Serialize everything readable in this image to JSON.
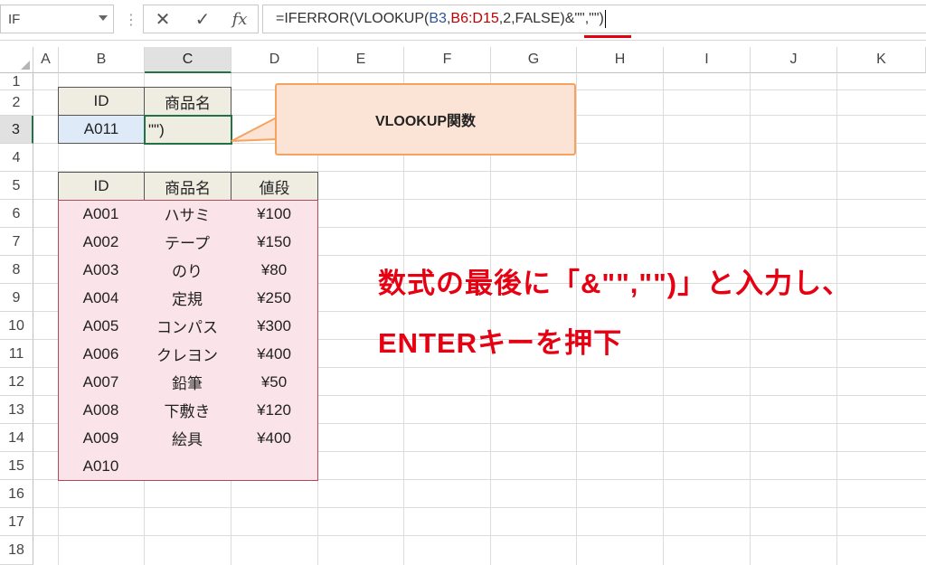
{
  "formula_bar": {
    "name_box": "IF",
    "cancel_icon": "✕",
    "enter_icon": "✓",
    "fx_label": "fx",
    "formula_parts": [
      "=IFERROR(VLOOKUP(",
      "B3",
      ",",
      "B6:D15",
      ",2,FALSE)&\"\",\"\")"
    ]
  },
  "columns": [
    "A",
    "B",
    "C",
    "D",
    "E",
    "F",
    "G",
    "H",
    "I",
    "J",
    "K"
  ],
  "rows": [
    "1",
    "2",
    "3",
    "4",
    "5",
    "6",
    "7",
    "8",
    "9",
    "10",
    "11",
    "12",
    "13",
    "14",
    "15",
    "16",
    "17",
    "18"
  ],
  "lookup": {
    "header_id": "ID",
    "header_name": "商品名",
    "id_value": "A011",
    "editing_value": "\"\")"
  },
  "table": {
    "headers": [
      "ID",
      "商品名",
      "値段"
    ],
    "rows": [
      [
        "A001",
        "ハサミ",
        "¥100"
      ],
      [
        "A002",
        "テープ",
        "¥150"
      ],
      [
        "A003",
        "のり",
        "¥80"
      ],
      [
        "A004",
        "定規",
        "¥250"
      ],
      [
        "A005",
        "コンパス",
        "¥300"
      ],
      [
        "A006",
        "クレヨン",
        "¥400"
      ],
      [
        "A007",
        "鉛筆",
        "¥50"
      ],
      [
        "A008",
        "下敷き",
        "¥120"
      ],
      [
        "A009",
        "絵具",
        "¥400"
      ],
      [
        "A010",
        "",
        ""
      ]
    ]
  },
  "callout": {
    "text": "VLOOKUP関数"
  },
  "annotation": {
    "line1": "数式の最後に「&\"\",\"\")」と入力し、",
    "line2": "ENTERキーを押下"
  },
  "colors": {
    "accent": "#217346",
    "annotation_red": "#e60012",
    "header_fill": "#efede1",
    "data_fill": "#fbe4e9",
    "lookup_fill": "#deeaf7",
    "callout_fill": "#fbe4d5",
    "callout_border": "#f4a460"
  }
}
